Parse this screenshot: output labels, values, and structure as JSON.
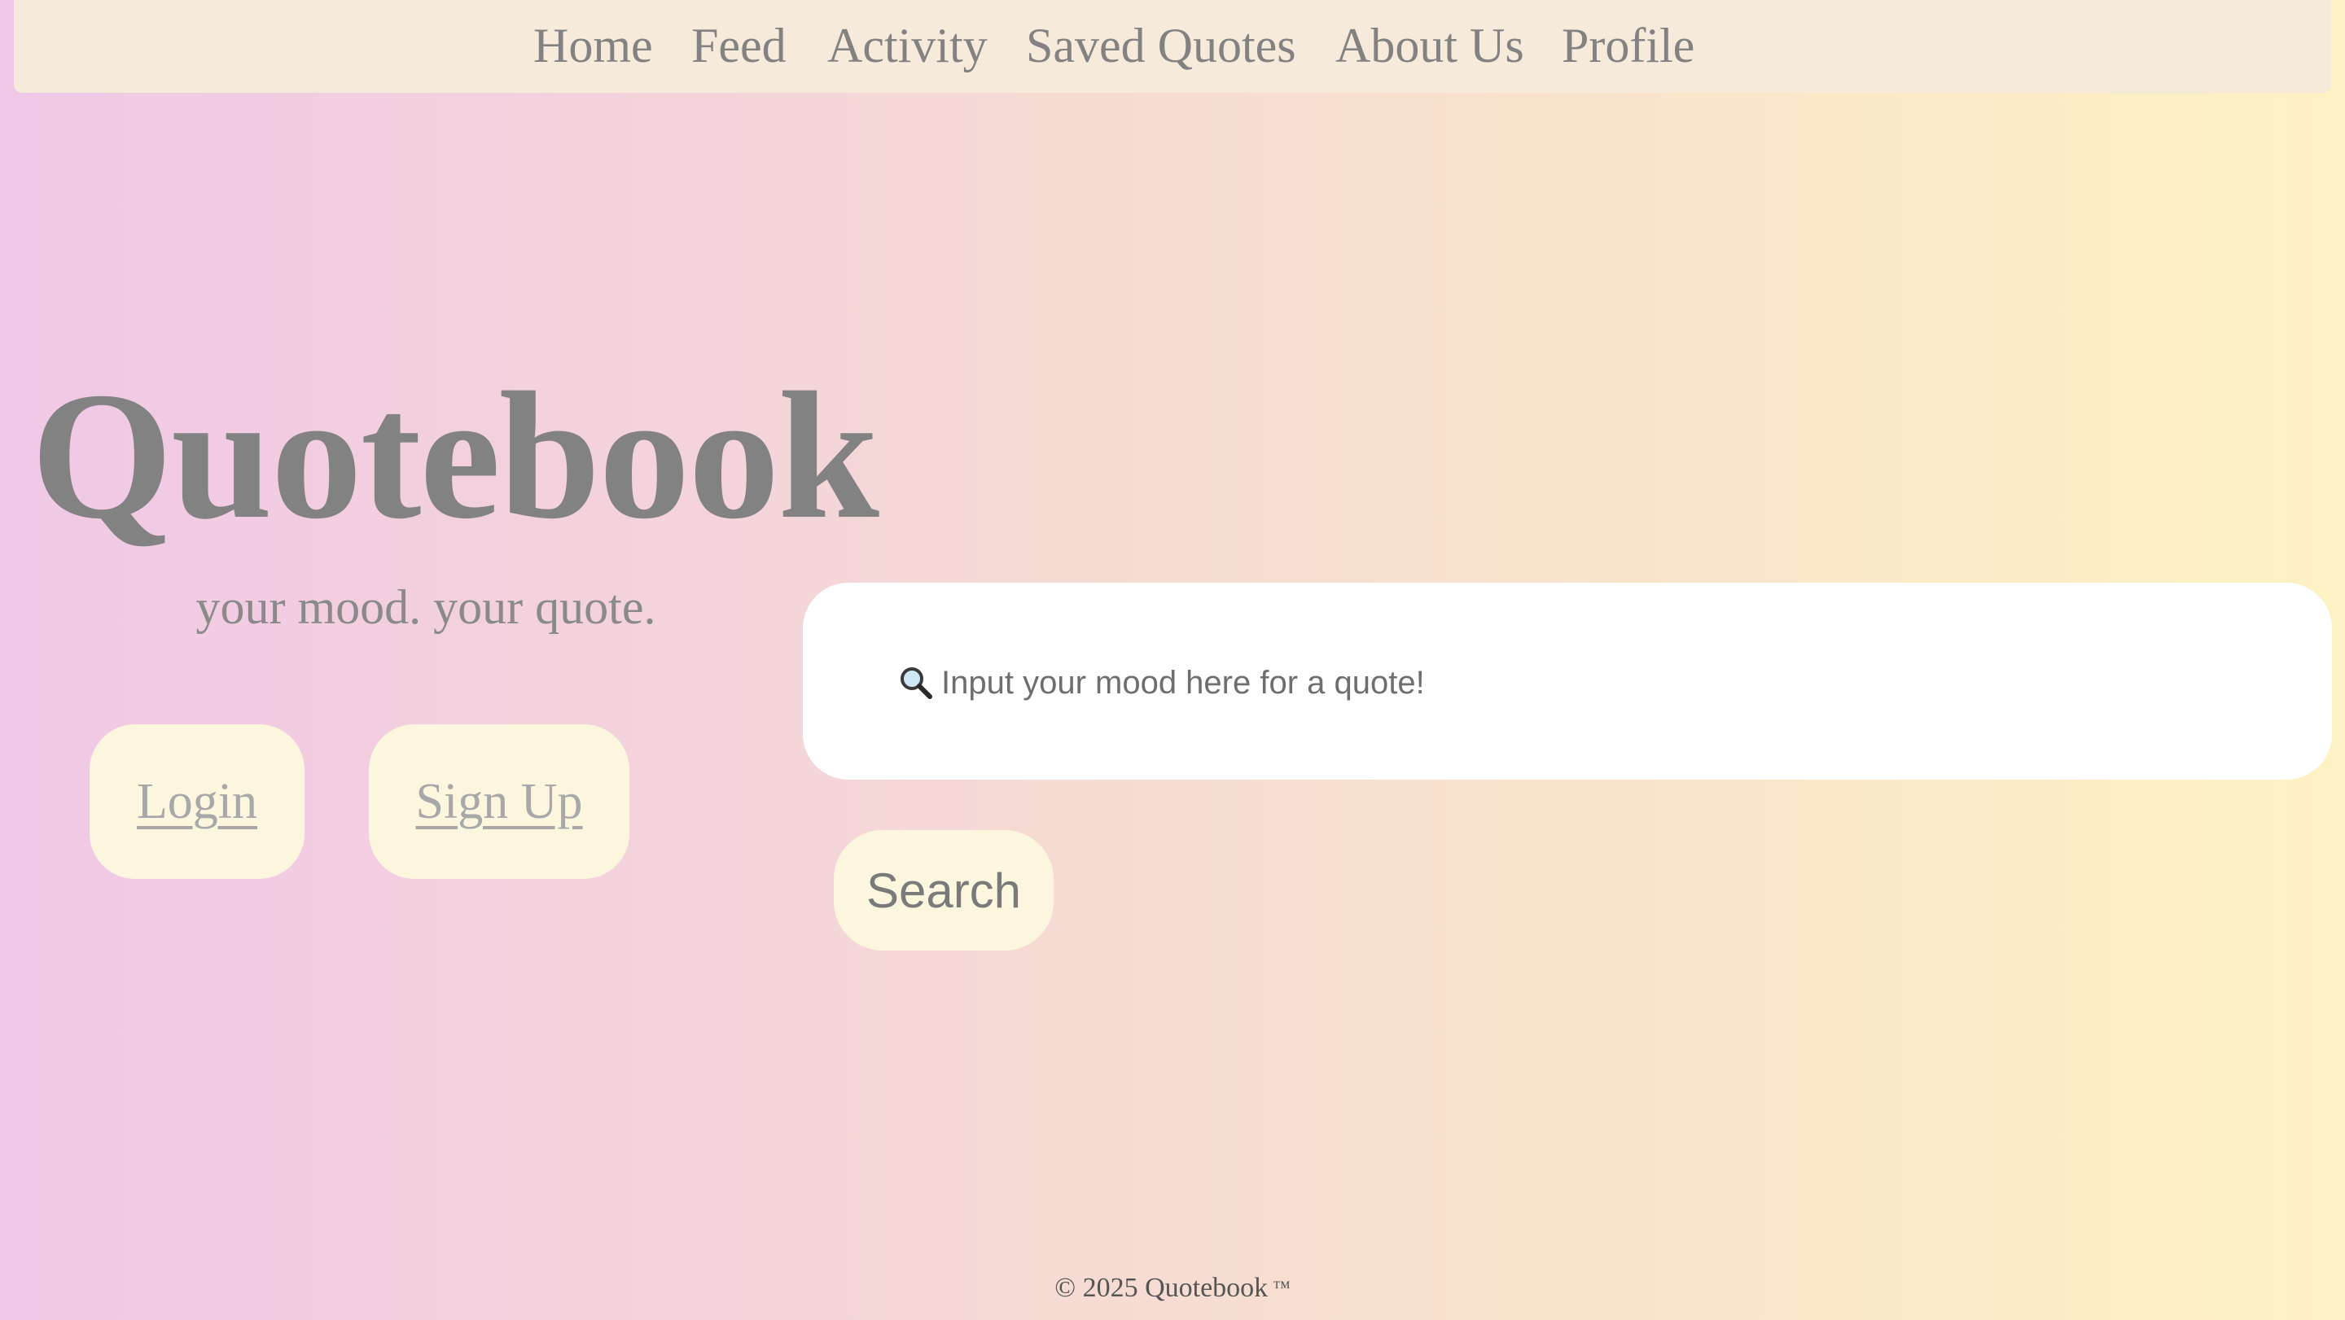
{
  "nav": {
    "items": [
      {
        "label": "Home"
      },
      {
        "label": "Feed"
      },
      {
        "label": "Activity"
      },
      {
        "label": "Saved Quotes"
      },
      {
        "label": "About Us"
      },
      {
        "label": "Profile"
      }
    ]
  },
  "hero": {
    "title": "Quotebook",
    "tagline": "your mood. your quote."
  },
  "auth": {
    "login_label": "Login",
    "signup_label": "Sign Up"
  },
  "search": {
    "placeholder": "Input your mood here for a quote!",
    "icon": "magnifying-glass-icon",
    "button_label": "Search"
  },
  "footer": {
    "text": "© 2025 Quotebook",
    "trademark": "™"
  },
  "colors": {
    "gradient_start": "#f0c8e6",
    "gradient_end": "#fdf2c4",
    "navbar_bg": "#f6ebda",
    "button_bg": "#fdf6df",
    "text_gray": "#828282"
  }
}
